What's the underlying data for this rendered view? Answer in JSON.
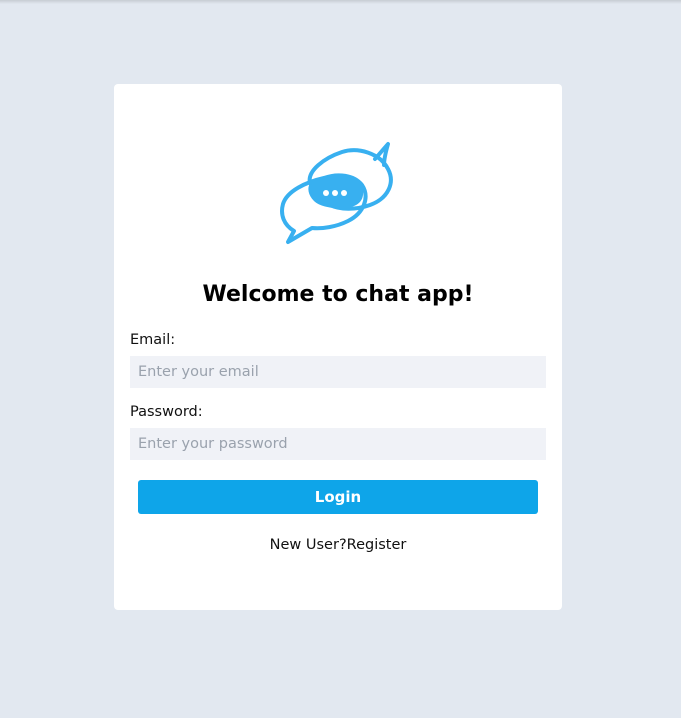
{
  "app": {
    "background_color": "#e2e8f0",
    "accent_color": "#0ea5e9",
    "logo_icon": "chat-bubbles-icon",
    "logo_color": "#38b0f0"
  },
  "login": {
    "title": "Welcome to chat app!",
    "email_label": "Email:",
    "email_placeholder": "Enter your email",
    "email_value": "",
    "password_label": "Password:",
    "password_placeholder": "Enter your password",
    "password_value": "",
    "login_button": "Login",
    "new_user_text": "New User?",
    "register_link": "Register"
  }
}
